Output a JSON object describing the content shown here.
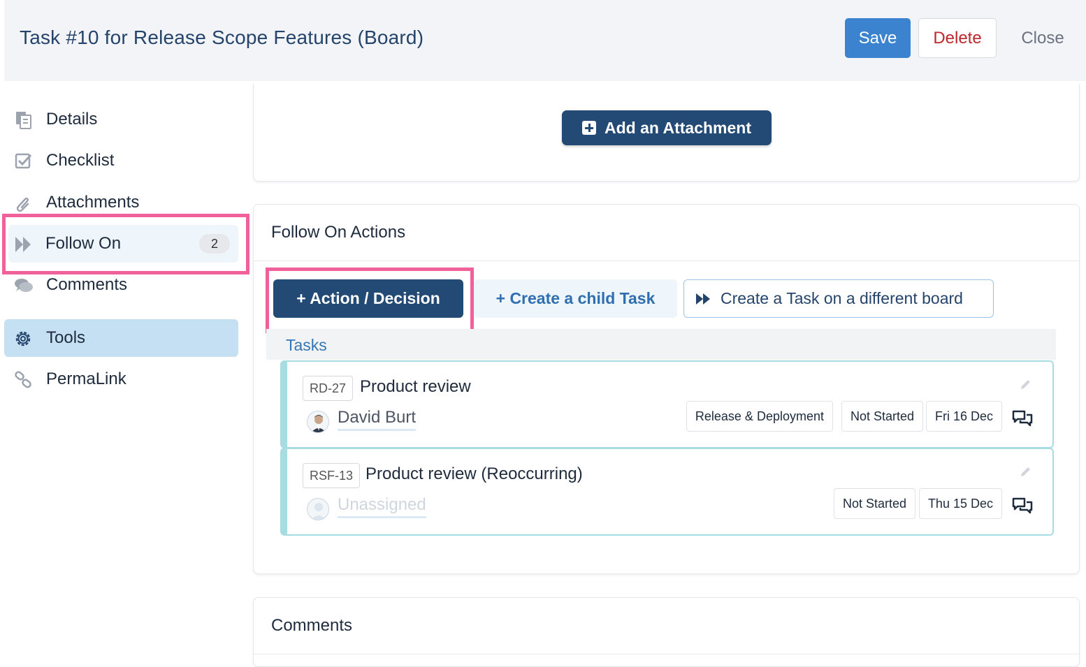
{
  "header": {
    "title": "Task #10 for Release Scope Features (Board)",
    "save_label": "Save",
    "delete_label": "Delete",
    "close_label": "Close"
  },
  "sidebar": {
    "items": [
      {
        "label": "Details",
        "icon": "document-icon"
      },
      {
        "label": "Checklist",
        "icon": "checkbox-icon"
      },
      {
        "label": "Attachments",
        "icon": "paperclip-icon"
      },
      {
        "label": "Follow On",
        "icon": "fast-forward-icon",
        "badge": "2"
      },
      {
        "label": "Comments",
        "icon": "comments-icon"
      },
      {
        "label": "Tools",
        "icon": "gear-icon"
      },
      {
        "label": "PermaLink",
        "icon": "link-icon"
      }
    ]
  },
  "attachments": {
    "add_label": "Add an Attachment"
  },
  "follow_on": {
    "title": "Follow On Actions",
    "action_label": "Action / Decision",
    "child_label": "Create a child Task",
    "different_board_label": "Create a Task on a different board",
    "tasks_label": "Tasks",
    "tasks": [
      {
        "code": "RD-27",
        "name": "Product review",
        "assignee": "David Burt",
        "board": "Release & Deployment",
        "status": "Not Started",
        "due": "Fri 16 Dec"
      },
      {
        "code": "RSF-13",
        "name": "Product review (Reoccurring)",
        "assignee": "Unassigned",
        "status": "Not Started",
        "due": "Thu 15 Dec"
      }
    ]
  },
  "comments": {
    "title": "Comments"
  },
  "colors": {
    "primary": "#234a75",
    "save": "#3b82cf",
    "delete": "#c0272d",
    "highlight": "#f0609a",
    "task_border": "#a8dce3"
  }
}
